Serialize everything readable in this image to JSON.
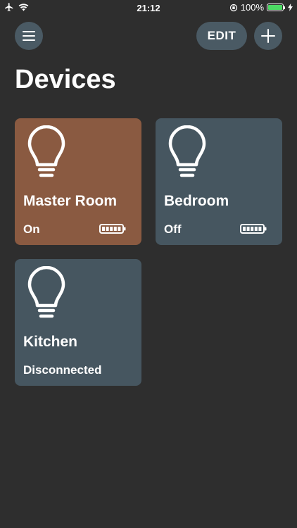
{
  "status_bar": {
    "time": "21:12",
    "battery_percent": "100%",
    "icons": [
      "airplane-icon",
      "wifi-icon",
      "orientation-lock-icon",
      "battery-icon",
      "charging-icon"
    ]
  },
  "header": {
    "edit_label": "EDIT",
    "menu_icon": "hamburger-menu-icon",
    "add_icon": "plus-icon"
  },
  "page": {
    "title": "Devices"
  },
  "devices": [
    {
      "name": "Master Room",
      "status": "On",
      "color": "#8a5a41",
      "battery_level": 1.0,
      "show_battery": true
    },
    {
      "name": "Bedroom",
      "status": "Off",
      "color": "#465660",
      "battery_level": 1.0,
      "show_battery": true
    },
    {
      "name": "Kitchen",
      "status": "Disconnected",
      "color": "#465660",
      "show_battery": false
    }
  ],
  "colors": {
    "background": "#2e2e2e",
    "button_bg": "#4a5a64",
    "card_on": "#8a5a41",
    "card_off": "#465660",
    "battery_green": "#4cd964"
  }
}
